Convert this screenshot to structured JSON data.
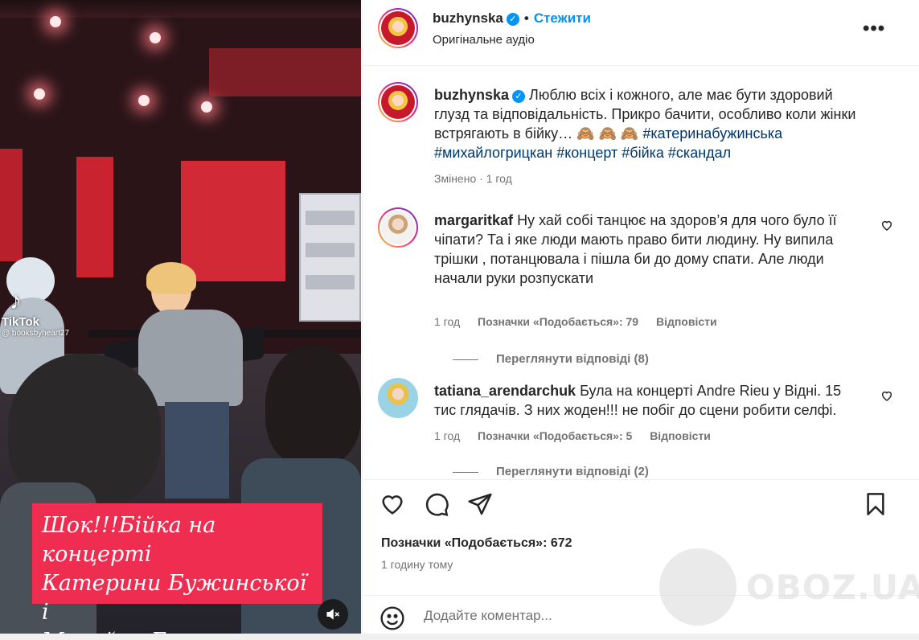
{
  "media": {
    "tiktok_label": "TikTok",
    "tiktok_handle": "@ booksbyheart27",
    "overlay_lines": [
      "Шок!!!Бійка на концерті",
      "Катерини Бужинської і",
      "Михайла Грицкана"
    ],
    "colors": {
      "caption_bg": "#ee2d50",
      "stage_red": "#c8232f"
    }
  },
  "header": {
    "username": "buzhynska",
    "follow_label": "Стежити",
    "audio_label": "Оригінальне аудіо",
    "more_label": "•••"
  },
  "caption": {
    "username": "buzhynska",
    "text": "Люблю всіх і кожного, але має бути здоровий глузд та відповідальність. Прикро бачити, особливо коли жінки встрягають в бійку… 🙈 🙈 🙈",
    "hashtags": [
      "#катеринабужинська",
      "#михайлогрицкан",
      "#концерт",
      "#бійка",
      "#скандал"
    ],
    "edited": "Змінено",
    "time": "1 год"
  },
  "comments": [
    {
      "username": "margaritkaf",
      "text": "Ну хай собі танцює на здоров’я для чого було її чіпати? Та і яке люди мають право бити людину. Ну випила трішки , потанцювала і пішла би до дому спати. Але люди начали руки розпускати",
      "time": "1 год",
      "likes": "Позначки «Подобається»: 79",
      "reply": "Відповісти",
      "view_replies": "Переглянути відповіді (8)"
    },
    {
      "username": "tatiana_arendarchuk",
      "text": "Була на концерті Andre Rieu у Відні. 15 тис глядачів. З них жоден!!! не побіг до сцени робити селфі.",
      "time": "1 год",
      "likes": "Позначки «Подобається»: 5",
      "reply": "Відповісти",
      "view_replies": "Переглянути відповіді (2)"
    }
  ],
  "actions": {
    "likes": "Позначки «Подобається»: 672",
    "time": "1 годину тому"
  },
  "add_comment": {
    "placeholder": "Додайте коментар..."
  },
  "watermark": {
    "text": "OBOZ.UA"
  },
  "icons": [
    "heart-icon",
    "comment-icon",
    "share-icon",
    "bookmark-icon",
    "emoji-icon",
    "mute-icon",
    "verified-badge-icon"
  ],
  "colors": {
    "link": "#0095f6",
    "hashtag": "#00376b",
    "muted": "#737373",
    "text": "#262626"
  }
}
